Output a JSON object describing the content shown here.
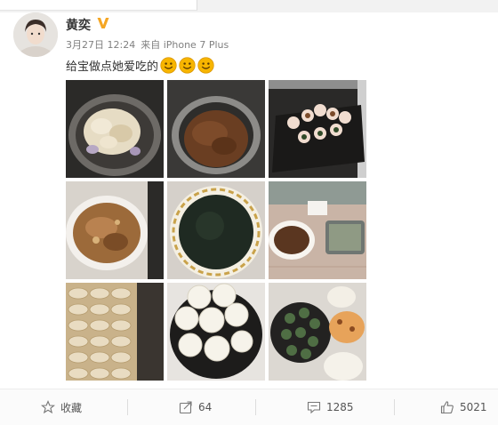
{
  "post": {
    "author": "黄奕",
    "date": "3月27日 12:24",
    "source": "来自 iPhone 7 Plus",
    "text": "给宝做点她爱吃的"
  },
  "icons": {
    "verified": "verified-v-badge-icon",
    "emoji": "smile-emoji-icon",
    "favorite": "star-icon",
    "repost": "share-arrow-icon",
    "comment": "comment-bubble-icon",
    "like": "thumbs-up-icon"
  },
  "colors": {
    "verified": "#f5a623",
    "emoji": "#f7b500",
    "text": "#333333",
    "meta": "#808080"
  },
  "actions": {
    "favorite_label": "收藏",
    "repost_count": "64",
    "comment_count": "1285",
    "like_count": "5021"
  }
}
